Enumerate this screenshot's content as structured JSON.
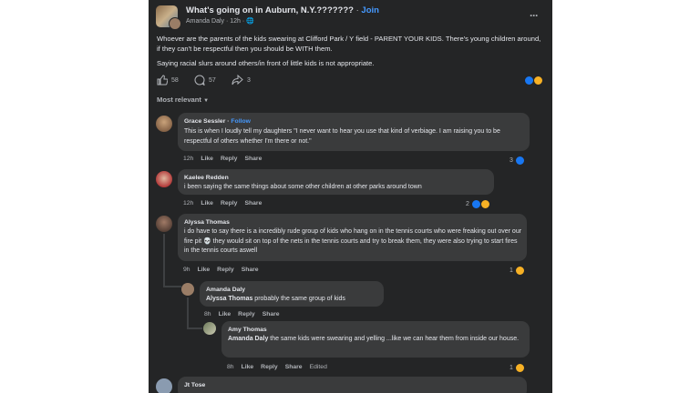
{
  "post": {
    "group_name": "What's going on in Auburn, N.Y.???????",
    "join_label": "Join",
    "author": "Amanda Daly",
    "time": "12h",
    "text_1": "Whoever are the parents of the kids swearing at  Clifford Park / Y field - PARENT YOUR KIDS. There's young children around, if they can't be respectful then you should be WITH them.",
    "text_2": "Saying racial slurs around others/in front of little kids is not appropriate.",
    "likes": "58",
    "comments": "57",
    "shares": "3",
    "sort_label": "Most relevant"
  },
  "comments": [
    {
      "name": "Grace Sessler",
      "follow": "Follow",
      "text": "This is when I loudly tell my daughters \"I never want to hear you use that kind of verbiage. I am raising you to be respectful of others whether I'm there or not.\"",
      "time": "12h",
      "like": "Like",
      "reply": "Reply",
      "share": "Share",
      "reactions": "3"
    },
    {
      "name": "Kaelee Redden",
      "text": "i been saying the same things about some other children at other parks around town",
      "time": "12h",
      "like": "Like",
      "reply": "Reply",
      "share": "Share",
      "reactions": "2"
    },
    {
      "name": "Alyssa Thomas",
      "text": "i do have to say there is a incredibly rude group of kids who hang on in the tennis courts who were freaking out over our fire pit 💀 they would sit on top of the nets in the tennis courts and try to break them, they were also trying to start fires in the tennis courts aswell",
      "time": "9h",
      "like": "Like",
      "reply": "Reply",
      "share": "Share",
      "reactions": "1"
    },
    {
      "name": "Amanda Daly",
      "mention": "Alyssa Thomas",
      "text": " probably the same group of kids",
      "time": "8h",
      "like": "Like",
      "reply": "Reply",
      "share": "Share"
    },
    {
      "name": "Amy Thomas",
      "mention": "Amanda Daly",
      "text": " the same kids were swearing and yelling ...like we can hear them from inside our house.",
      "time": "8h",
      "like": "Like",
      "reply": "Reply",
      "share": "Share",
      "edited": "Edited",
      "reactions": "1"
    },
    {
      "name": "Jt Tose"
    }
  ],
  "colors": {
    "panel": "#242526",
    "bubble": "#3a3b3c",
    "accent": "#4599ff",
    "like": "#1877f2"
  }
}
